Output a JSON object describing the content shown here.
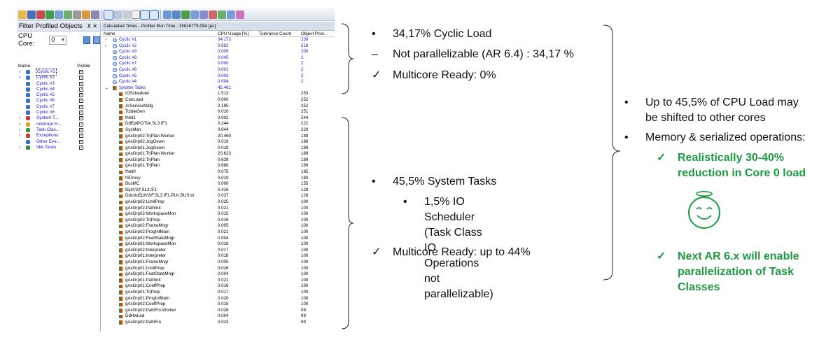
{
  "grid": {
    "title": "Calculated Times - Profiler Run Time : 15816775.094 [µs]",
    "columns": {
      "name": "Name",
      "cpu": "CPU Usage [%]",
      "tolerance": "Tolerance Count",
      "priority": "Object Prior..."
    },
    "rows": [
      {
        "name": "Cyclic #1",
        "cpu": "34.172",
        "priority": "230",
        "level": 1,
        "kind": "cyclic",
        "expander": "›"
      },
      {
        "name": "Cyclic #2",
        "cpu": "0.892",
        "priority": "218",
        "level": 1,
        "kind": "cyclic",
        "expander": "›"
      },
      {
        "name": "Cyclic #3",
        "cpu": "0.009",
        "priority": "200",
        "level": 1,
        "kind": "cyclic",
        "expander": ""
      },
      {
        "name": "Cyclic #8",
        "cpu": "0.045",
        "priority": "2",
        "level": 1,
        "kind": "cyclic",
        "expander": ""
      },
      {
        "name": "Cyclic #7",
        "cpu": "0.000",
        "priority": "2",
        "level": 1,
        "kind": "cyclic",
        "expander": ""
      },
      {
        "name": "Cyclic #6",
        "cpu": "0.001",
        "priority": "2",
        "level": 1,
        "kind": "cyclic",
        "expander": ""
      },
      {
        "name": "Cyclic #5",
        "cpu": "0.003",
        "priority": "2",
        "level": 1,
        "kind": "cyclic",
        "expander": ""
      },
      {
        "name": "Cyclic #4",
        "cpu": "0.004",
        "priority": "2",
        "level": 1,
        "kind": "cyclic",
        "expander": ""
      },
      {
        "name": "System Tasks",
        "cpu": "45.461",
        "priority": "",
        "level": 1,
        "kind": "bar",
        "expander": "⌄"
      },
      {
        "name": "IOScheduler",
        "cpu": "1.513",
        "priority": "253",
        "level": 2,
        "kind": "bar"
      },
      {
        "name": "CpuLoad",
        "cpu": "0.000",
        "priority": "252",
        "level": 2,
        "kind": "bar"
      },
      {
        "name": "ArServiceWdg",
        "cpu": "0.195",
        "priority": "252",
        "level": 2,
        "kind": "bar"
      },
      {
        "name": "TcIdleGen",
        "cpu": "0.010",
        "priority": "251",
        "level": 2,
        "kind": "bar"
      },
      {
        "name": "tNet1",
        "cpu": "0.002",
        "priority": "244",
        "level": 2,
        "kind": "bar"
      },
      {
        "name": "DdEplPCITsk.SL3.IF1",
        "cpu": "0.244",
        "priority": "222",
        "level": 2,
        "kind": "bar"
      },
      {
        "name": "SysMan",
        "cpu": "0.044",
        "priority": "220",
        "level": 2,
        "kind": "bar"
      },
      {
        "name": "gAxGrp02:TrjPlan:Worker",
        "cpu": "20.460",
        "priority": "189",
        "level": 2,
        "kind": "bar"
      },
      {
        "name": "gAxGrp02:JogGeom",
        "cpu": "0.019",
        "priority": "189",
        "level": 2,
        "kind": "bar"
      },
      {
        "name": "gAxGrp01:JogGeom",
        "cpu": "0.019",
        "priority": "189",
        "level": 2,
        "kind": "bar"
      },
      {
        "name": "gAxGrp01:TrjPlan:Worker",
        "cpu": "20.623",
        "priority": "189",
        "level": 2,
        "kind": "bar"
      },
      {
        "name": "gAxGrp02:TrjPlan",
        "cpu": "0.639",
        "priority": "189",
        "level": 2,
        "kind": "bar"
      },
      {
        "name": "gAxGrp01:TrjPlan",
        "cpu": "0.688",
        "priority": "189",
        "level": 2,
        "kind": "bar"
      },
      {
        "name": "fNet0",
        "cpu": "0.075",
        "priority": "185",
        "level": 2,
        "kind": "bar"
      },
      {
        "name": "tSProxy",
        "cpu": "0.019",
        "priority": "183",
        "level": 2,
        "kind": "bar"
      },
      {
        "name": "BusMC",
        "cpu": "0.000",
        "priority": "155",
        "level": 2,
        "kind": "bar"
      },
      {
        "name": "tEplV2If.SL3.IF1",
        "cpu": "0.416",
        "priority": "128",
        "level": 2,
        "kind": "bar"
      },
      {
        "name": "DdxxloEplV2IF.SL3.IF1.PLK.BUS.tri",
        "cpu": "0.037",
        "priority": "128",
        "level": 2,
        "kind": "bar"
      },
      {
        "name": "gAxGrp02:LimitPrep",
        "cpu": "0.025",
        "priority": "100",
        "level": 2,
        "kind": "bar"
      },
      {
        "name": "gAxGrp02:PathInit",
        "cpu": "0.021",
        "priority": "100",
        "level": 2,
        "kind": "bar"
      },
      {
        "name": "gAxGrp02:WorkspaceMon",
        "cpu": "0.015",
        "priority": "100",
        "level": 2,
        "kind": "bar"
      },
      {
        "name": "gAxGrp02:TrjPrep",
        "cpu": "0.016",
        "priority": "100",
        "level": 2,
        "kind": "bar"
      },
      {
        "name": "gAxGrp02:FrameMngr",
        "cpu": "0.005",
        "priority": "100",
        "level": 2,
        "kind": "bar"
      },
      {
        "name": "gAxGrp02:ProgIntMain",
        "cpu": "0.021",
        "priority": "100",
        "level": 2,
        "kind": "bar"
      },
      {
        "name": "gAxGrp02:FeatStateMngr",
        "cpu": "0.004",
        "priority": "100",
        "level": 2,
        "kind": "bar"
      },
      {
        "name": "gAxGrp01:WorkspaceMon",
        "cpu": "0.016",
        "priority": "100",
        "level": 2,
        "kind": "bar"
      },
      {
        "name": "gAxGrp02:Interpreter",
        "cpu": "0.017",
        "priority": "100",
        "level": 2,
        "kind": "bar"
      },
      {
        "name": "gAxGrp01:Interpreter",
        "cpu": "0.018",
        "priority": "100",
        "level": 2,
        "kind": "bar"
      },
      {
        "name": "gAxGrp01:FrameMngr",
        "cpu": "0.005",
        "priority": "100",
        "level": 2,
        "kind": "bar"
      },
      {
        "name": "gAxGrp01:LimitPrep",
        "cpu": "0.026",
        "priority": "100",
        "level": 2,
        "kind": "bar"
      },
      {
        "name": "gAxGrp01:FeatStateMngr",
        "cpu": "0.004",
        "priority": "100",
        "level": 2,
        "kind": "bar"
      },
      {
        "name": "gAxGrp01:PathInit",
        "cpu": "0.021",
        "priority": "100",
        "level": 2,
        "kind": "bar"
      },
      {
        "name": "gAxGrp01:CoeffPrep",
        "cpu": "0.016",
        "priority": "100",
        "level": 2,
        "kind": "bar"
      },
      {
        "name": "gAxGrp01:TrjPrep",
        "cpu": "0.017",
        "priority": "100",
        "level": 2,
        "kind": "bar"
      },
      {
        "name": "gAxGrp01:ProgIntMain",
        "cpu": "0.020",
        "priority": "100",
        "level": 2,
        "kind": "bar"
      },
      {
        "name": "gAxGrp02:CoeffPrep",
        "cpu": "0.015",
        "priority": "100",
        "level": 2,
        "kind": "bar"
      },
      {
        "name": "gAxGrp02:PathFin:Worker",
        "cpu": "0.026",
        "priority": "99",
        "level": 2,
        "kind": "bar"
      },
      {
        "name": "DdHwLed",
        "cpu": "0.004",
        "priority": "99",
        "level": 2,
        "kind": "bar"
      },
      {
        "name": "gAxGrp02:PathFin",
        "cpu": "0.023",
        "priority": "99",
        "level": 2,
        "kind": "bar"
      }
    ]
  },
  "filter_panel": {
    "title": "Filter Profiled Objects",
    "pin_close": "⊼ ✕",
    "cpu_core_label": "CPU Core:",
    "cpu_core_value": "0",
    "col_name": "Name",
    "col_visible": "Visible",
    "items": [
      {
        "label": "Cyclic #1",
        "expander": "›",
        "blue": true,
        "selected": true,
        "icon_color": "#3b6fc7"
      },
      {
        "label": "Cyclic #2",
        "expander": "›",
        "blue": true,
        "selected": false,
        "icon_color": "#3b6fc7"
      },
      {
        "label": "Cyclic #3",
        "expander": "",
        "blue": true,
        "selected": false,
        "icon_color": "#3b6fc7"
      },
      {
        "label": "Cyclic #4",
        "expander": "",
        "blue": true,
        "selected": false,
        "icon_color": "#3b6fc7"
      },
      {
        "label": "Cyclic #5",
        "expander": "",
        "blue": true,
        "selected": false,
        "icon_color": "#3b6fc7"
      },
      {
        "label": "Cyclic #6",
        "expander": "",
        "blue": true,
        "selected": false,
        "icon_color": "#3b6fc7"
      },
      {
        "label": "Cyclic #7",
        "expander": "",
        "blue": true,
        "selected": false,
        "icon_color": "#3b6fc7"
      },
      {
        "label": "Cyclic #8",
        "expander": "",
        "blue": true,
        "selected": false,
        "icon_color": "#3b6fc7"
      },
      {
        "label": "System T...",
        "expander": "›",
        "blue": true,
        "selected": false,
        "icon_color": "#c63a3a"
      },
      {
        "label": "Interrupt H...",
        "expander": "›",
        "blue": true,
        "selected": false,
        "icon_color": "#e0a020"
      },
      {
        "label": "Task Clas...",
        "expander": "›",
        "blue": true,
        "selected": false,
        "icon_color": "#3a8a3a"
      },
      {
        "label": "Exceptions",
        "expander": "›",
        "blue": true,
        "selected": false,
        "icon_color": "#c63a3a"
      },
      {
        "label": "Other Eve...",
        "expander": "",
        "blue": true,
        "selected": false,
        "icon_color": "#3a6fc7"
      },
      {
        "label": "Idle Tasks",
        "expander": "›",
        "blue": true,
        "selected": false,
        "icon_color": "#3a8a3a"
      }
    ],
    "check_mark": "✓"
  },
  "notes": {
    "cyclic": [
      {
        "mark": "•",
        "text": "34,17% Cyclic Load"
      },
      {
        "mark": "–",
        "text": "Not parallelizable (AR 6.4) : 34,17 %"
      },
      {
        "mark": "✓",
        "text": "Multicore Ready: 0%"
      }
    ],
    "system": {
      "bullet": {
        "mark": "•",
        "text": "45,5% System Tasks"
      },
      "sub_mark": "•",
      "sub_lines": [
        "1,5% IO Scheduler (Task Class",
        "IO Operations not",
        "parallelizable)"
      ],
      "check": {
        "mark": "✓",
        "text": "Multicore Ready: up to 44%"
      }
    },
    "summary": {
      "mark1": "•",
      "line1a": "Up to 45,5% of CPU Load may",
      "line1b": "be shifted to other cores",
      "mark2": "•",
      "line2": "Memory & serialized operations:",
      "check_mark": "✓",
      "green1a": "Realistically 30-40%",
      "green1b": "reduction in Core 0 load",
      "green2a": "Next AR 6.x will enable",
      "green2b": "parallelization of Task",
      "green2c": "Classes"
    }
  },
  "colors": {
    "accent_green": "#1e9a42",
    "link_blue": "#1515c8"
  }
}
